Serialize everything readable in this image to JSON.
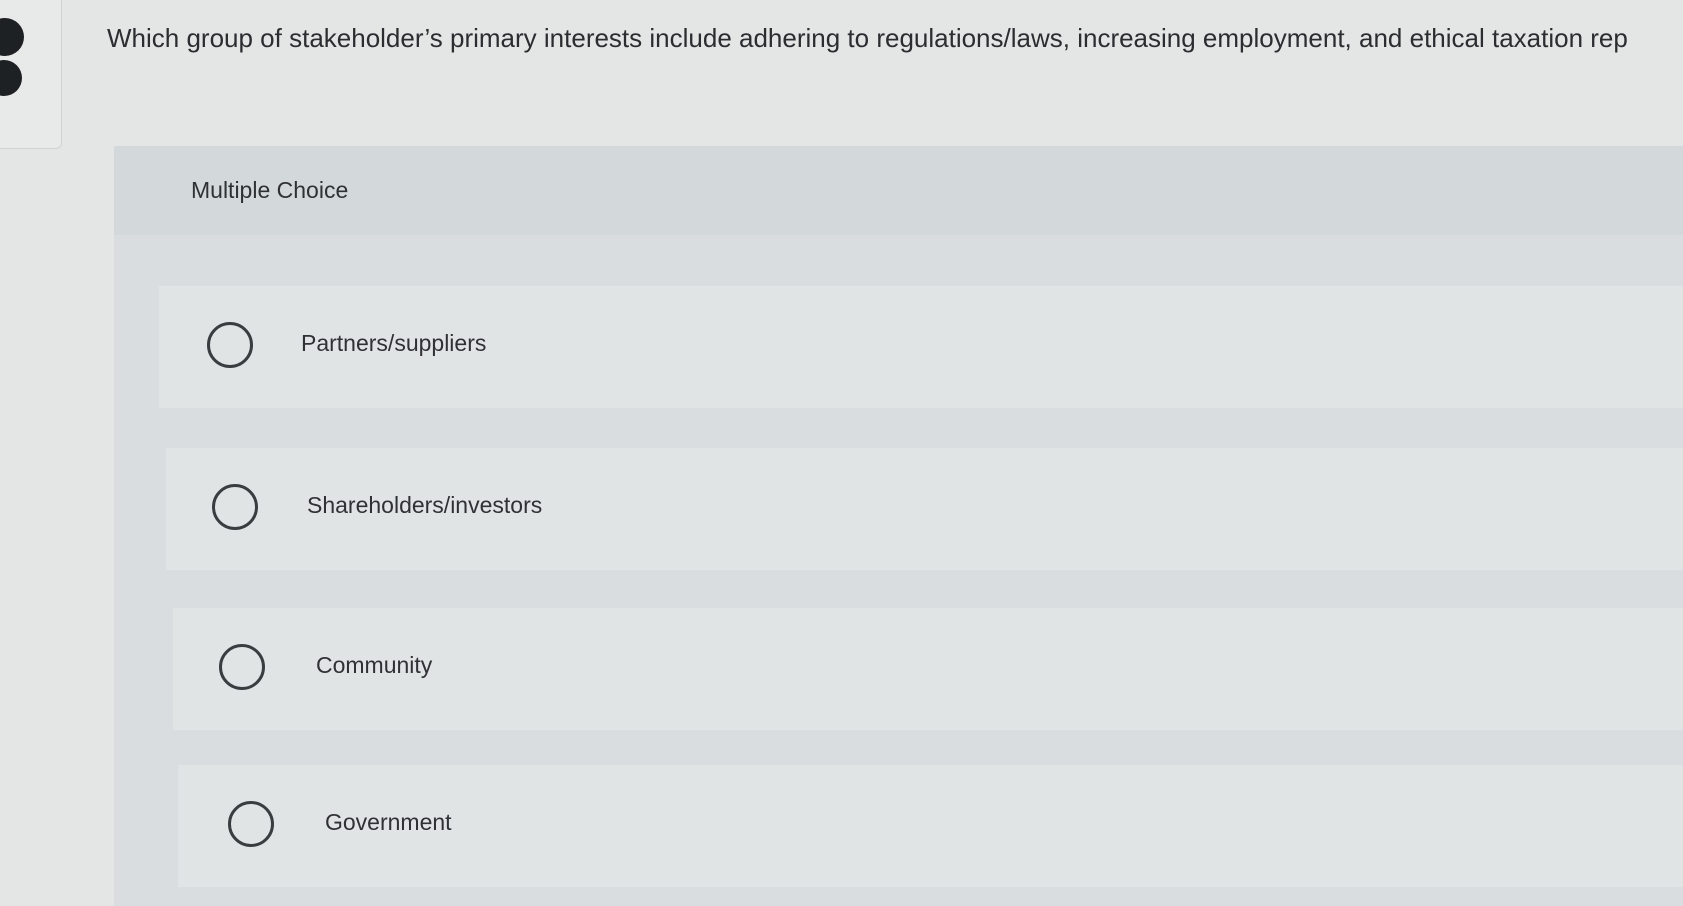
{
  "question": {
    "text": "Which group of stakeholder’s primary interests include adhering to regulations/laws, increasing employment, and ethical taxation rep"
  },
  "multiple_choice": {
    "title": "Multiple Choice",
    "options": [
      {
        "label": "Partners/suppliers",
        "selected": false
      },
      {
        "label": "Shareholders/investors",
        "selected": false
      },
      {
        "label": "Community",
        "selected": false
      },
      {
        "label": "Government",
        "selected": false
      }
    ]
  },
  "colors": {
    "page_background": "#e4e6e6",
    "panel_header": "#d3d8db",
    "option_row": "#e1e4e5",
    "radio_border": "#3a3d40",
    "text": "#2e3033"
  }
}
